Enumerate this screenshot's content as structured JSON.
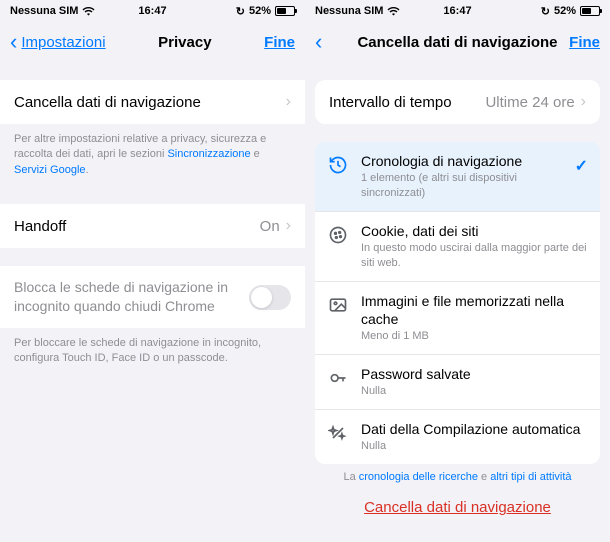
{
  "statusbar": {
    "carrier": "Nessuna SIM",
    "time": "16:47",
    "battery_pct": "52%"
  },
  "left": {
    "nav": {
      "back": "Impostazioni",
      "title": "Privacy",
      "done": "Fine"
    },
    "row_clear": "Cancella dati di navigazione",
    "footer1_a": "Per altre impostazioni relative a privacy, sicurezza e raccolta dei dati, apri le sezioni ",
    "footer1_link1": "Sincronizzazione",
    "footer1_b": " e ",
    "footer1_link2": "Servizi Google",
    "footer1_c": ".",
    "row_handoff": "Handoff",
    "handoff_value": "On",
    "row_lock": "Blocca le schede di navigazione in incognito quando chiudi Chrome",
    "footer2": "Per bloccare le schede di navigazione in incognito, configura Touch ID, Face ID o un passcode."
  },
  "right": {
    "nav": {
      "title": "Cancella dati di navigazione",
      "done": "Fine"
    },
    "row_range_label": "Intervallo di tempo",
    "row_range_value": "Ultime 24 ore",
    "items": [
      {
        "title": "Cronologia di navigazione",
        "sub": "1 elemento (e altri sui dispositivi sincronizzati)",
        "selected": true
      },
      {
        "title": "Cookie, dati dei siti",
        "sub": "In questo modo uscirai dalla maggior parte dei siti web."
      },
      {
        "title": "Immagini e file memorizzati nella cache",
        "sub": "Meno di 1 MB"
      },
      {
        "title": "Password salvate",
        "sub": "Nulla"
      },
      {
        "title": "Dati della Compilazione automatica",
        "sub": "Nulla"
      }
    ],
    "bottom_a": "La ",
    "bottom_link1": "cronologia delle ricerche",
    "bottom_b": " e ",
    "bottom_link2": "altri tipi di attività",
    "delete_btn": "Cancella dati di navigazione"
  }
}
